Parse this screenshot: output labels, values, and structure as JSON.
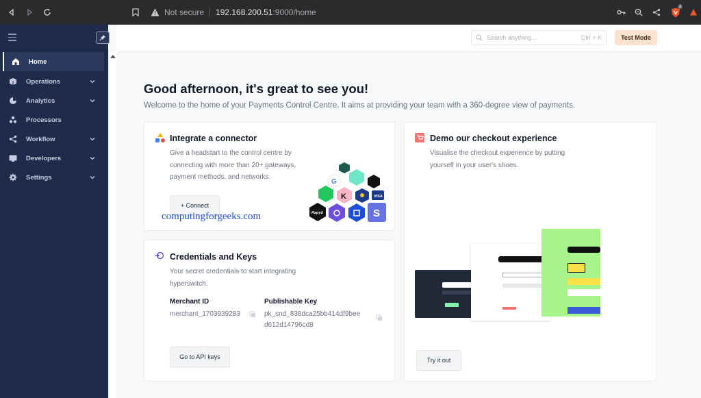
{
  "browser": {
    "security_text": "Not secure",
    "url_host": "192.168.200.51",
    "url_rest": ":9000/home",
    "shield_badge": "2"
  },
  "sidebar": {
    "items": [
      {
        "label": "Home",
        "icon": "home-icon",
        "active": true,
        "expandable": false
      },
      {
        "label": "Operations",
        "icon": "operations-icon",
        "active": false,
        "expandable": true
      },
      {
        "label": "Analytics",
        "icon": "pie-chart-icon",
        "active": false,
        "expandable": true
      },
      {
        "label": "Processors",
        "icon": "processors-icon",
        "active": false,
        "expandable": false
      },
      {
        "label": "Workflow",
        "icon": "share-icon",
        "active": false,
        "expandable": true
      },
      {
        "label": "Developers",
        "icon": "monitor-icon",
        "active": false,
        "expandable": true
      },
      {
        "label": "Settings",
        "icon": "gear-icon",
        "active": false,
        "expandable": true
      }
    ]
  },
  "topbar": {
    "search_placeholder": "Search anything...",
    "search_shortcut": "Ctrl + K",
    "mode_label": "Test Mode"
  },
  "main": {
    "greeting": "Good afternoon, it's great to see you!",
    "subtitle": "Welcome to the home of your Payments Control Centre. It aims at providing your team with a 360-degree view of payments."
  },
  "cards": {
    "connector": {
      "title": "Integrate a connector",
      "desc_line1": "Give a headstart to the control centre by",
      "desc_line2": "connecting with more than 20+ gateways,",
      "desc_line3": "payment methods, and networks.",
      "button": "+ Connect",
      "logos": [
        {
          "text": "G",
          "color": "#ffffff"
        },
        {
          "text": "K",
          "color": "#f8b4c7"
        },
        {
          "text": "VISA",
          "color": "#1a3a8f"
        },
        {
          "text": "Rapyd",
          "color": "#111111"
        },
        {
          "text": "S",
          "color": "#6772e5"
        }
      ]
    },
    "checkout": {
      "title": "Demo our checkout experience",
      "desc_line1": "Visualise the checkout experience by putting",
      "desc_line2": "yourself in your user's shoes.",
      "button": "Try it out"
    },
    "credentials": {
      "title": "Credentials and Keys",
      "desc_line1": "Your secret credentials to start integrating",
      "desc_line2": "hyperswitch.",
      "merchant_label": "Merchant ID",
      "merchant_value": "merchant_1703939283",
      "pk_label": "Publishable Key",
      "pk_line1": "pk_snd_838dca25bb414df9bee",
      "pk_line2": "d612d14796cd8",
      "button": "Go to API keys"
    }
  },
  "watermark": "computingforgeeks.com",
  "colors": {
    "sidebar_bg": "#1f2b4a",
    "test_mode_bg": "#fde3cf",
    "accent_blue": "#1f4fd1"
  }
}
